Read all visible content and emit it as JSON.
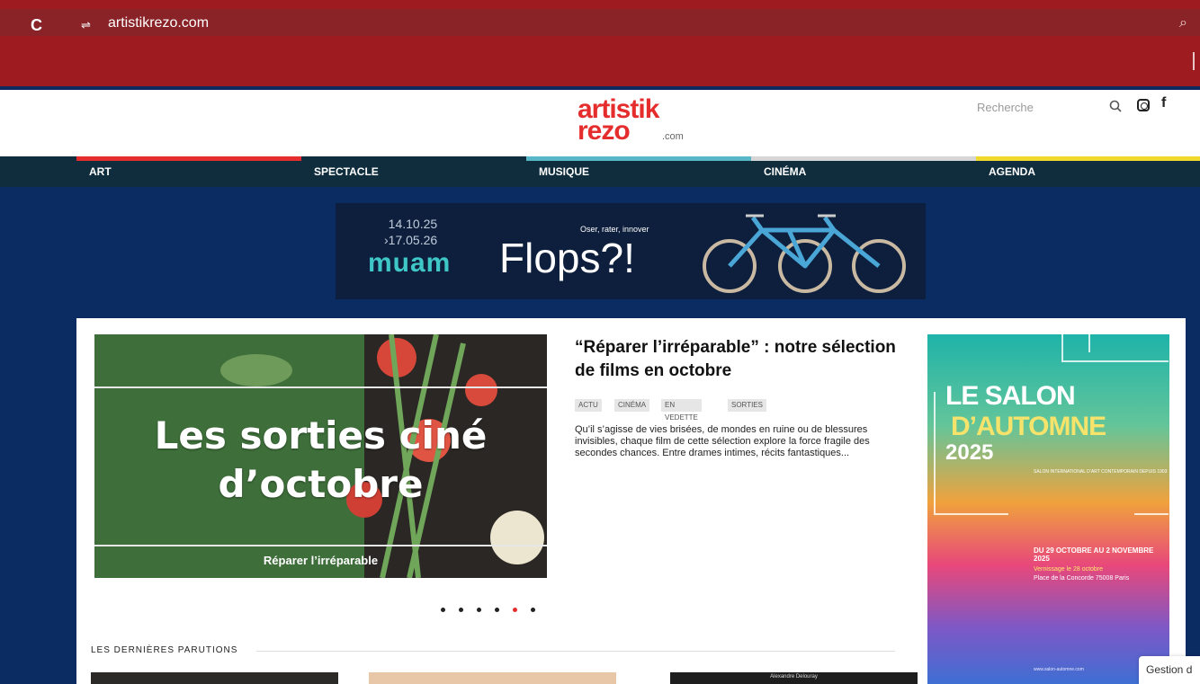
{
  "browser": {
    "url": "artistikrezo.com",
    "site_info_glyph": "⇌",
    "reload_glyph": "C",
    "search_glyph": "⌕"
  },
  "header": {
    "logo_line1": "artistik",
    "logo_line2": "rezo",
    "logo_suffix": ".com",
    "search_placeholder": "Recherche",
    "facebook_glyph": "f"
  },
  "nav": {
    "items": [
      {
        "label": "ART",
        "color": "#e52d2d"
      },
      {
        "label": "SPECTACLE",
        "color": "#0f2d3d"
      },
      {
        "label": "MUSIQUE",
        "color": "#59b8c8"
      },
      {
        "label": "CINÉMA",
        "color": "#d6d6d6"
      },
      {
        "label": "AGENDA",
        "color": "#f0d92c"
      }
    ]
  },
  "ad_banner": {
    "date_start": "14.10.25",
    "date_end": "›17.05.26",
    "museum": "muam",
    "tagline": "Oser, rater, innover",
    "title": "Flops?!"
  },
  "featured": {
    "slide_title": "Les sorties ciné d’octobre",
    "slide_caption": "Réparer l’irréparable",
    "article_title": "“Réparer l’irréparable” : notre sélection de films en octobre",
    "tags": [
      "ACTU",
      "CINÉMA",
      "EN VEDETTE",
      "SORTIES"
    ],
    "excerpt": "Qu’il s’agisse de vies brisées, de mondes en ruine ou de blessures invisibles, chaque film de cette sélection explore la force fragile des secondes chances. Entre drames intimes, récits fantastiques..."
  },
  "slider": {
    "dot_count": 6,
    "active_index": 4
  },
  "latest": {
    "section_title": "LES DERNIÈRES PARUTIONS",
    "thumb_label": "Alexandre Delouray"
  },
  "side_ad": {
    "title_line1": "LE SALON",
    "title_line2": "D’AUTOMNE",
    "year": "2025",
    "subtitle": "SALON INTERNATIONAL D’ART CONTEMPORAIN DEPUIS 1903",
    "dates": "DU 29 OCTOBRE AU 2 NOVEMBRE 2025",
    "vernissage": "Vernissage le 28 octobre",
    "place": "Place de la Concorde 75008 Paris",
    "url": "www.salon-automne.com"
  },
  "cookie": {
    "label": "Gestion d"
  },
  "colors": {
    "chrome": "#9e1c1f",
    "page_bg": "#0b2b63",
    "nav_bg": "#0f2d3d",
    "brand_red": "#e52d2d"
  }
}
